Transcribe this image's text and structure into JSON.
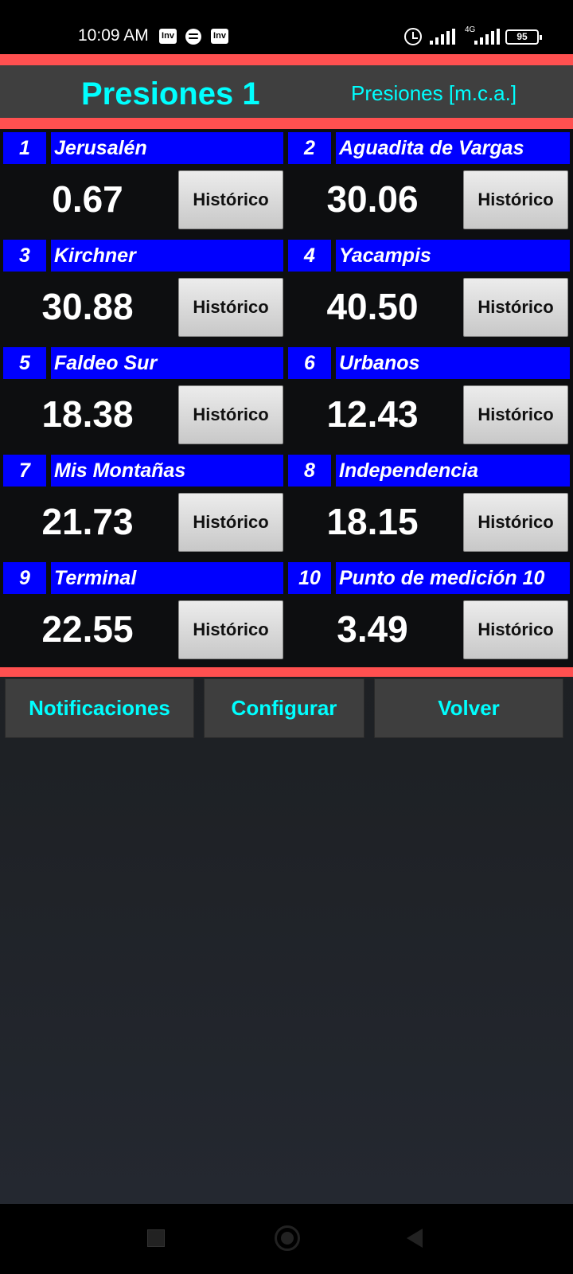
{
  "status_bar": {
    "time": "10:09 AM",
    "icons": [
      "inv-app-icon",
      "spotify-icon",
      "inv-app-icon",
      "alarm-icon",
      "signal-icon",
      "signal-4g-icon",
      "battery-icon"
    ],
    "inv_label": "Inv",
    "network": "4G",
    "battery": "95"
  },
  "header": {
    "title": "Presiones 1",
    "unit": "Presiones [m.c.a.]"
  },
  "stations": [
    {
      "num": "1",
      "name": "Jerusalén",
      "value": "0.67",
      "button": "Histórico"
    },
    {
      "num": "2",
      "name": "Aguadita de Vargas",
      "value": "30.06",
      "button": "Histórico"
    },
    {
      "num": "3",
      "name": "Kirchner",
      "value": "30.88",
      "button": "Histórico"
    },
    {
      "num": "4",
      "name": "Yacampis",
      "value": "40.50",
      "button": "Histórico"
    },
    {
      "num": "5",
      "name": "Faldeo Sur",
      "value": "18.38",
      "button": "Histórico"
    },
    {
      "num": "6",
      "name": "Urbanos",
      "value": "12.43",
      "button": "Histórico"
    },
    {
      "num": "7",
      "name": "Mis Montañas",
      "value": "21.73",
      "button": "Histórico"
    },
    {
      "num": "8",
      "name": "Independencia",
      "value": "18.15",
      "button": "Histórico"
    },
    {
      "num": "9",
      "name": "Terminal",
      "value": "22.55",
      "button": "Histórico"
    },
    {
      "num": "10",
      "name": "Punto de medición 10",
      "value": "3.49",
      "button": "Histórico"
    }
  ],
  "bottom_buttons": {
    "notifications": "Notificaciones",
    "configure": "Configurar",
    "back": "Volver"
  },
  "colors": {
    "accent": "#00ffff",
    "label_bg": "#0000ff",
    "separator": "#ff5050",
    "header_bg": "#3f3f3f"
  }
}
